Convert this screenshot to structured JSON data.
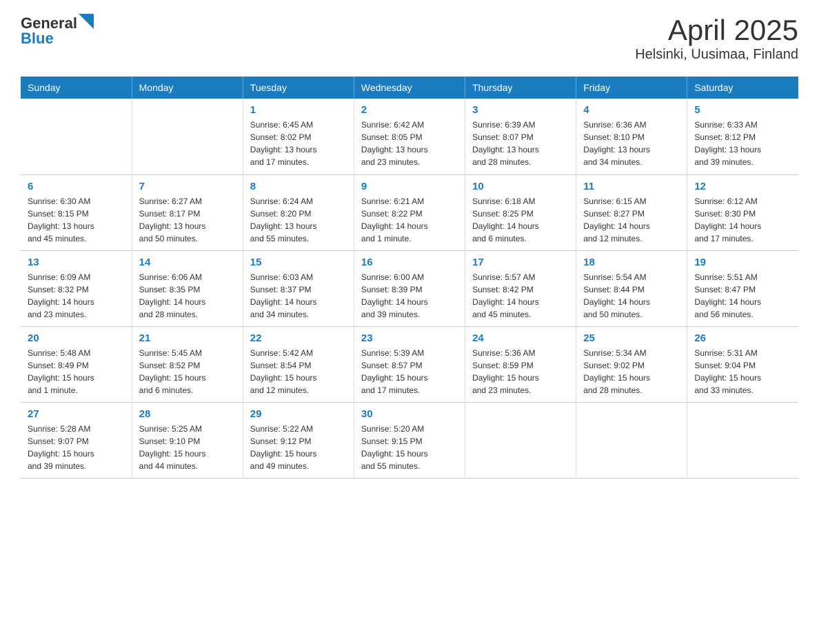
{
  "header": {
    "logo_general": "General",
    "logo_blue": "Blue",
    "title": "April 2025",
    "subtitle": "Helsinki, Uusimaa, Finland"
  },
  "days_of_week": [
    "Sunday",
    "Monday",
    "Tuesday",
    "Wednesday",
    "Thursday",
    "Friday",
    "Saturday"
  ],
  "weeks": [
    [
      {
        "day": "",
        "info": ""
      },
      {
        "day": "",
        "info": ""
      },
      {
        "day": "1",
        "info": "Sunrise: 6:45 AM\nSunset: 8:02 PM\nDaylight: 13 hours\nand 17 minutes."
      },
      {
        "day": "2",
        "info": "Sunrise: 6:42 AM\nSunset: 8:05 PM\nDaylight: 13 hours\nand 23 minutes."
      },
      {
        "day": "3",
        "info": "Sunrise: 6:39 AM\nSunset: 8:07 PM\nDaylight: 13 hours\nand 28 minutes."
      },
      {
        "day": "4",
        "info": "Sunrise: 6:36 AM\nSunset: 8:10 PM\nDaylight: 13 hours\nand 34 minutes."
      },
      {
        "day": "5",
        "info": "Sunrise: 6:33 AM\nSunset: 8:12 PM\nDaylight: 13 hours\nand 39 minutes."
      }
    ],
    [
      {
        "day": "6",
        "info": "Sunrise: 6:30 AM\nSunset: 8:15 PM\nDaylight: 13 hours\nand 45 minutes."
      },
      {
        "day": "7",
        "info": "Sunrise: 6:27 AM\nSunset: 8:17 PM\nDaylight: 13 hours\nand 50 minutes."
      },
      {
        "day": "8",
        "info": "Sunrise: 6:24 AM\nSunset: 8:20 PM\nDaylight: 13 hours\nand 55 minutes."
      },
      {
        "day": "9",
        "info": "Sunrise: 6:21 AM\nSunset: 8:22 PM\nDaylight: 14 hours\nand 1 minute."
      },
      {
        "day": "10",
        "info": "Sunrise: 6:18 AM\nSunset: 8:25 PM\nDaylight: 14 hours\nand 6 minutes."
      },
      {
        "day": "11",
        "info": "Sunrise: 6:15 AM\nSunset: 8:27 PM\nDaylight: 14 hours\nand 12 minutes."
      },
      {
        "day": "12",
        "info": "Sunrise: 6:12 AM\nSunset: 8:30 PM\nDaylight: 14 hours\nand 17 minutes."
      }
    ],
    [
      {
        "day": "13",
        "info": "Sunrise: 6:09 AM\nSunset: 8:32 PM\nDaylight: 14 hours\nand 23 minutes."
      },
      {
        "day": "14",
        "info": "Sunrise: 6:06 AM\nSunset: 8:35 PM\nDaylight: 14 hours\nand 28 minutes."
      },
      {
        "day": "15",
        "info": "Sunrise: 6:03 AM\nSunset: 8:37 PM\nDaylight: 14 hours\nand 34 minutes."
      },
      {
        "day": "16",
        "info": "Sunrise: 6:00 AM\nSunset: 8:39 PM\nDaylight: 14 hours\nand 39 minutes."
      },
      {
        "day": "17",
        "info": "Sunrise: 5:57 AM\nSunset: 8:42 PM\nDaylight: 14 hours\nand 45 minutes."
      },
      {
        "day": "18",
        "info": "Sunrise: 5:54 AM\nSunset: 8:44 PM\nDaylight: 14 hours\nand 50 minutes."
      },
      {
        "day": "19",
        "info": "Sunrise: 5:51 AM\nSunset: 8:47 PM\nDaylight: 14 hours\nand 56 minutes."
      }
    ],
    [
      {
        "day": "20",
        "info": "Sunrise: 5:48 AM\nSunset: 8:49 PM\nDaylight: 15 hours\nand 1 minute."
      },
      {
        "day": "21",
        "info": "Sunrise: 5:45 AM\nSunset: 8:52 PM\nDaylight: 15 hours\nand 6 minutes."
      },
      {
        "day": "22",
        "info": "Sunrise: 5:42 AM\nSunset: 8:54 PM\nDaylight: 15 hours\nand 12 minutes."
      },
      {
        "day": "23",
        "info": "Sunrise: 5:39 AM\nSunset: 8:57 PM\nDaylight: 15 hours\nand 17 minutes."
      },
      {
        "day": "24",
        "info": "Sunrise: 5:36 AM\nSunset: 8:59 PM\nDaylight: 15 hours\nand 23 minutes."
      },
      {
        "day": "25",
        "info": "Sunrise: 5:34 AM\nSunset: 9:02 PM\nDaylight: 15 hours\nand 28 minutes."
      },
      {
        "day": "26",
        "info": "Sunrise: 5:31 AM\nSunset: 9:04 PM\nDaylight: 15 hours\nand 33 minutes."
      }
    ],
    [
      {
        "day": "27",
        "info": "Sunrise: 5:28 AM\nSunset: 9:07 PM\nDaylight: 15 hours\nand 39 minutes."
      },
      {
        "day": "28",
        "info": "Sunrise: 5:25 AM\nSunset: 9:10 PM\nDaylight: 15 hours\nand 44 minutes."
      },
      {
        "day": "29",
        "info": "Sunrise: 5:22 AM\nSunset: 9:12 PM\nDaylight: 15 hours\nand 49 minutes."
      },
      {
        "day": "30",
        "info": "Sunrise: 5:20 AM\nSunset: 9:15 PM\nDaylight: 15 hours\nand 55 minutes."
      },
      {
        "day": "",
        "info": ""
      },
      {
        "day": "",
        "info": ""
      },
      {
        "day": "",
        "info": ""
      }
    ]
  ]
}
